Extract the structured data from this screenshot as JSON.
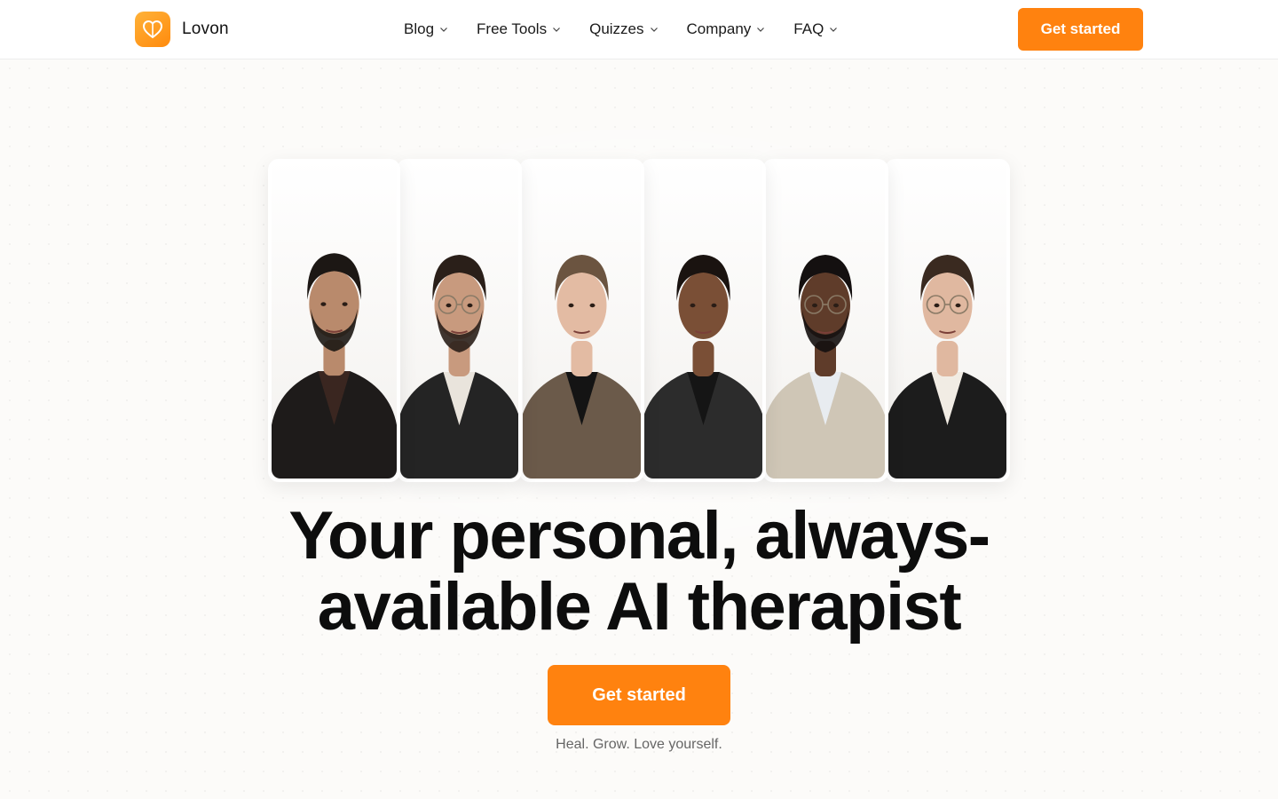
{
  "header": {
    "brand_name": "Lovon",
    "nav": [
      {
        "label": "Blog"
      },
      {
        "label": "Free Tools"
      },
      {
        "label": "Quizzes"
      },
      {
        "label": "Company"
      },
      {
        "label": "FAQ"
      }
    ],
    "cta_label": "Get started"
  },
  "colors": {
    "accent": "#ff820f",
    "logo_gradient_start": "#ffb238",
    "logo_gradient_end": "#ff8a0d",
    "text": "#0d0d0d",
    "muted": "#666666"
  },
  "hero": {
    "headline_line1": "Your personal, always-",
    "headline_line2": "available AI therapist",
    "cta_label": "Get started",
    "tagline": "Heal. Grow. Love yourself."
  },
  "portraits": [
    {
      "name": "therapist-portrait-1",
      "hair": "#1c1714",
      "skin": "#b98a6c",
      "jacket": "#1e1b1a",
      "shirt": "#3a2620",
      "glasses": false,
      "beard": true
    },
    {
      "name": "therapist-portrait-2",
      "hair": "#2a1f19",
      "skin": "#c89a7e",
      "jacket": "#242424",
      "shirt": "#e9e4dc",
      "glasses": true,
      "beard": true
    },
    {
      "name": "therapist-portrait-3",
      "hair": "#6b5440",
      "skin": "#e3bba3",
      "jacket": "#6b5a4a",
      "shirt": "#141414",
      "glasses": false,
      "beard": false
    },
    {
      "name": "therapist-portrait-4",
      "hair": "#1a1310",
      "skin": "#7a4f36",
      "jacket": "#2c2c2c",
      "shirt": "#151515",
      "glasses": false,
      "beard": false
    },
    {
      "name": "therapist-portrait-5",
      "hair": "#141010",
      "skin": "#5f3c2a",
      "jacket": "#cfc6b6",
      "shirt": "#e8ecf0",
      "glasses": true,
      "beard": true
    },
    {
      "name": "therapist-portrait-6",
      "hair": "#3a2a20",
      "skin": "#e0b8a0",
      "jacket": "#1c1c1c",
      "shirt": "#f1ece4",
      "glasses": true,
      "beard": false
    }
  ]
}
